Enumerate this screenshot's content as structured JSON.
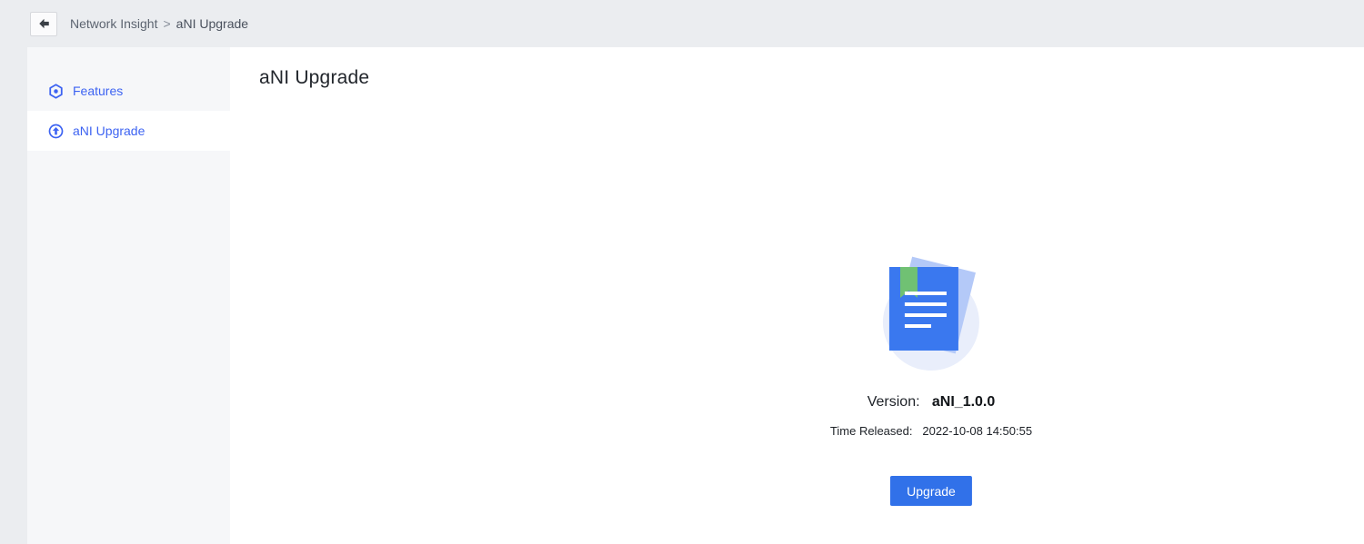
{
  "topbar": {
    "back_icon": "arrow-left-icon",
    "breadcrumb": {
      "parent": "Network Insight",
      "separator": ">",
      "current": "aNI Upgrade"
    }
  },
  "sidebar": {
    "items": [
      {
        "label": "Features",
        "icon": "hexagon-dot-icon",
        "active": false
      },
      {
        "label": "aNI Upgrade",
        "icon": "arrow-up-circle-icon",
        "active": true
      }
    ]
  },
  "main": {
    "title": "aNI Upgrade",
    "upgrade": {
      "illustration": "document-with-bookmark-icon",
      "version_label": "Version:",
      "version_value": "aNI_1.0.0",
      "time_label": "Time Released:",
      "time_value": "2022-10-08 14:50:55",
      "button_label": "Upgrade"
    }
  },
  "colors": {
    "page_bg": "#ebedf0",
    "sidebar_bg": "#f6f7f9",
    "link_blue": "#3d63f2",
    "button_blue": "#3171e9",
    "doc_blue": "#3a78ef",
    "back_page_blue": "#b4c9f8",
    "circle_blue": "#e9eefb",
    "bookmark_green": "#70c173"
  }
}
